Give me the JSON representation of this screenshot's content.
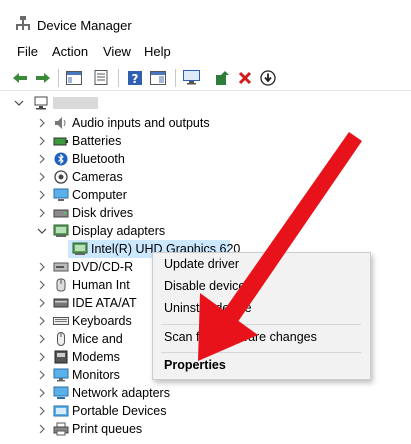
{
  "window": {
    "title": "Device Manager"
  },
  "menu": [
    "File",
    "Action",
    "View",
    "Help"
  ],
  "toolbar": {
    "icons": [
      "back-arrow-icon",
      "forward-arrow-icon",
      "show-hide-tree-icon",
      "properties-icon",
      "help-icon",
      "action-pane-icon",
      "scan-hardware-icon",
      "update-driver-icon",
      "uninstall-icon",
      "download-icon"
    ]
  },
  "tree": {
    "root": {
      "label": "",
      "redacted": true
    },
    "categories": [
      {
        "label": "Audio inputs and outputs",
        "icon": "audio-icon"
      },
      {
        "label": "Batteries",
        "icon": "battery-icon"
      },
      {
        "label": "Bluetooth",
        "icon": "bluetooth-icon"
      },
      {
        "label": "Cameras",
        "icon": "camera-icon"
      },
      {
        "label": "Computer",
        "icon": "computer-icon"
      },
      {
        "label": "Disk drives",
        "icon": "disk-drive-icon"
      },
      {
        "label": "Display adapters",
        "icon": "display-adapter-icon",
        "expanded": true
      },
      {
        "label": "Intel(R) UHD Graphics 620",
        "icon": "display-adapter-icon",
        "child": true,
        "selected": true
      },
      {
        "label": "DVD/CD-R",
        "icon": "dvd-icon"
      },
      {
        "label": "Human Int",
        "icon": "human-interface-icon"
      },
      {
        "label": "IDE ATA/AT",
        "icon": "ide-icon"
      },
      {
        "label": "Keyboards",
        "icon": "keyboard-icon"
      },
      {
        "label": "Mice and",
        "icon": "mouse-icon"
      },
      {
        "label": "Modems",
        "icon": "modem-icon"
      },
      {
        "label": "Monitors",
        "icon": "monitor-icon"
      },
      {
        "label": "Network adapters",
        "icon": "network-adapter-icon"
      },
      {
        "label": "Portable Devices",
        "icon": "portable-device-icon"
      },
      {
        "label": "Print queues",
        "icon": "printer-icon"
      }
    ]
  },
  "context_menu": {
    "update_driver": "Update driver",
    "disable_device": "Disable device",
    "uninstall_device": "Uninstall device",
    "scan": "Scan for hardware changes",
    "properties": "Properties"
  },
  "annotation": {
    "arrow_color": "#e8121b"
  },
  "colors": {
    "selection": "#cce8ff",
    "menu_bg": "#f2f2f2"
  }
}
